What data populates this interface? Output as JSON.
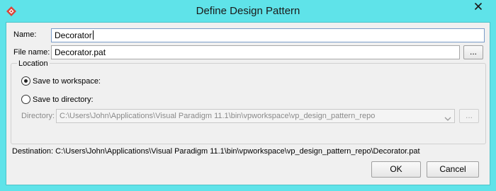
{
  "window": {
    "title": "Define Design Pattern",
    "app_icon": "visual-paradigm-logo-icon",
    "close_icon": "close-icon",
    "accent_color": "#5fe3e9"
  },
  "form": {
    "name_label": "Name:",
    "name_value": "Decorator",
    "filename_label": "File name:",
    "filename_value": "Decorator.pat",
    "browse_file_label": "...",
    "location": {
      "legend": "Location",
      "save_workspace_label": "Save to workspace:",
      "save_workspace_selected": true,
      "save_directory_label": "Save to directory:",
      "save_directory_selected": false,
      "directory_label": "Directory:",
      "directory_value": "C:\\Users\\John\\Applications\\Visual Paradigm 11.1\\bin\\vpworkspace\\vp_design_pattern_repo",
      "directory_browse_label": "..."
    },
    "destination_text": "Destination: C:\\Users\\John\\Applications\\Visual Paradigm 11.1\\bin\\vpworkspace\\vp_design_pattern_repo\\Decorator.pat"
  },
  "buttons": {
    "ok_label": "OK",
    "cancel_label": "Cancel"
  }
}
